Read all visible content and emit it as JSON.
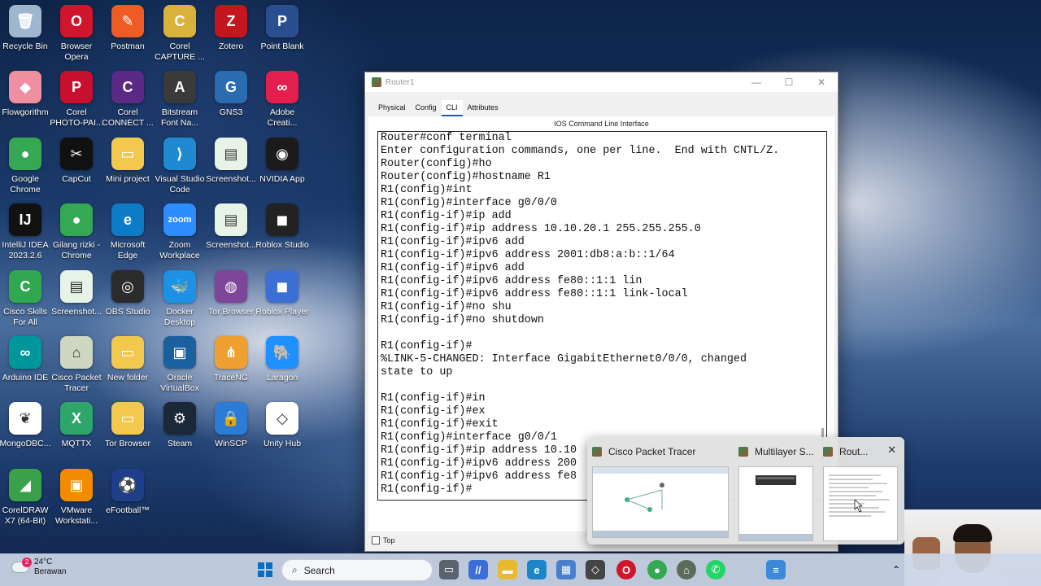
{
  "desktop": {
    "icons": [
      {
        "label": "Recycle Bin",
        "icon": "recycle-bin-icon",
        "color": "#9fb6cf",
        "glyph": "🗑"
      },
      {
        "label": "Browser Opera",
        "icon": "opera-icon",
        "color": "#d0152c",
        "glyph": "O"
      },
      {
        "label": "Postman",
        "icon": "postman-icon",
        "color": "#ef5b25",
        "glyph": "✎"
      },
      {
        "label": "Corel CAPTURE ...",
        "icon": "corel-capture-icon",
        "color": "#d9b23c",
        "glyph": "C"
      },
      {
        "label": "Zotero",
        "icon": "zotero-icon",
        "color": "#c4161c",
        "glyph": "Z"
      },
      {
        "label": "Point Blank",
        "icon": "point-blank-icon",
        "color": "#2a4e8f",
        "glyph": "P"
      },
      {
        "label": "Flowgorithm",
        "icon": "flowgorithm-icon",
        "color": "#f08fa0",
        "glyph": "◆"
      },
      {
        "label": "Corel PHOTO-PAI...",
        "icon": "corel-photopaint-icon",
        "color": "#c8102e",
        "glyph": "P"
      },
      {
        "label": "Corel CONNECT ...",
        "icon": "corel-connect-icon",
        "color": "#5b2a86",
        "glyph": "C"
      },
      {
        "label": "Bitstream Font Na...",
        "icon": "bitstream-icon",
        "color": "#3a3a3a",
        "glyph": "A"
      },
      {
        "label": "GNS3",
        "icon": "gns3-icon",
        "color": "#2b6cb0",
        "glyph": "G"
      },
      {
        "label": "Adobe Creati...",
        "icon": "adobe-cc-icon",
        "color": "#e3204d",
        "glyph": "∞"
      },
      {
        "label": "Google Chrome",
        "icon": "chrome-icon",
        "color": "#34a853",
        "glyph": "●"
      },
      {
        "label": "CapCut",
        "icon": "capcut-icon",
        "color": "#111111",
        "glyph": "✂"
      },
      {
        "label": "Mini project",
        "icon": "folder-icon",
        "color": "#f2c94c",
        "glyph": "▭"
      },
      {
        "label": "Visual Studio Code",
        "icon": "vscode-icon",
        "color": "#1f8ad2",
        "glyph": "⟩"
      },
      {
        "label": "Screenshot...",
        "icon": "screenshot-file-icon",
        "color": "#e8f3e8",
        "glyph": "▤"
      },
      {
        "label": "NVIDIA App",
        "icon": "nvidia-icon",
        "color": "#1b1b1b",
        "glyph": "◉"
      },
      {
        "label": "IntelliJ IDEA 2023.2.6",
        "icon": "intellij-icon",
        "color": "#111111",
        "glyph": "IJ"
      },
      {
        "label": "Gilang rizki - Chrome",
        "icon": "chrome-profile-icon",
        "color": "#34a853",
        "glyph": "●"
      },
      {
        "label": "Microsoft Edge",
        "icon": "edge-icon",
        "color": "#0c7cc6",
        "glyph": "e"
      },
      {
        "label": "Zoom Workplace",
        "icon": "zoom-icon",
        "color": "#2d8cff",
        "glyph": "zoom"
      },
      {
        "label": "Screenshot...",
        "icon": "screenshot-file-icon",
        "color": "#e8f3e8",
        "glyph": "▤"
      },
      {
        "label": "Roblox Studio",
        "icon": "roblox-studio-icon",
        "color": "#222222",
        "glyph": "◼"
      },
      {
        "label": "Cisco Skills For All",
        "icon": "cisco-skills-icon",
        "color": "#2fa84f",
        "glyph": "C"
      },
      {
        "label": "Screenshot...",
        "icon": "screenshot-file-icon",
        "color": "#e8f3e8",
        "glyph": "▤"
      },
      {
        "label": "OBS Studio",
        "icon": "obs-icon",
        "color": "#2b2b2b",
        "glyph": "◎"
      },
      {
        "label": "Docker Desktop",
        "icon": "docker-icon",
        "color": "#1d91e6",
        "glyph": "🐳"
      },
      {
        "label": "Tor Browser",
        "icon": "tor-icon",
        "color": "#7d4698",
        "glyph": "◍"
      },
      {
        "label": "Roblox Player",
        "icon": "roblox-player-icon",
        "color": "#3b6fd4",
        "glyph": "◼"
      },
      {
        "label": "Arduino IDE",
        "icon": "arduino-icon",
        "color": "#00979c",
        "glyph": "∞"
      },
      {
        "label": "Cisco Packet Tracer",
        "icon": "packet-tracer-icon",
        "color": "#cfd6c2",
        "glyph": "⌂"
      },
      {
        "label": "New folder",
        "icon": "folder-icon",
        "color": "#f2c94c",
        "glyph": "▭"
      },
      {
        "label": "Oracle VirtualBox",
        "icon": "virtualbox-icon",
        "color": "#1a5f9e",
        "glyph": "▣"
      },
      {
        "label": "TraceNG",
        "icon": "traceng-icon",
        "color": "#f0a030",
        "glyph": "⋔"
      },
      {
        "label": "Laragon",
        "icon": "laragon-icon",
        "color": "#1e90ff",
        "glyph": "🐘"
      },
      {
        "label": "MongoDBC...",
        "icon": "mongodb-icon",
        "color": "#ffffff",
        "glyph": "❦"
      },
      {
        "label": "MQTTX",
        "icon": "mqttx-icon",
        "color": "#2ea56b",
        "glyph": "X"
      },
      {
        "label": "Tor Browser",
        "icon": "folder-icon",
        "color": "#f2c94c",
        "glyph": "▭"
      },
      {
        "label": "Steam",
        "icon": "steam-icon",
        "color": "#1b2838",
        "glyph": "⚙"
      },
      {
        "label": "WinSCP",
        "icon": "winscp-icon",
        "color": "#2c7bd6",
        "glyph": "🔒"
      },
      {
        "label": "Unity Hub",
        "icon": "unity-icon",
        "color": "#ffffff",
        "glyph": "◇"
      },
      {
        "label": "CorelDRAW X7 (64-Bit)",
        "icon": "coreldraw-icon",
        "color": "#3aa14a",
        "glyph": "◢"
      },
      {
        "label": "VMware Workstati...",
        "icon": "vmware-icon",
        "color": "#f38b00",
        "glyph": "▣"
      },
      {
        "label": "eFootball™",
        "icon": "efootball-icon",
        "color": "#1f3f8a",
        "glyph": "⚽"
      }
    ]
  },
  "window": {
    "title": "Router1",
    "tabs": [
      {
        "label": "Physical",
        "active": false
      },
      {
        "label": "Config",
        "active": false
      },
      {
        "label": "CLI",
        "active": true
      },
      {
        "label": "Attributes",
        "active": false
      }
    ],
    "panel_title": "IOS Command Line Interface",
    "top_checkbox_label": "Top",
    "cli_lines": [
      "Router#conf terminal",
      "Enter configuration commands, one per line.  End with CNTL/Z.",
      "Router(config)#ho",
      "Router(config)#hostname R1",
      "R1(config)#int",
      "R1(config)#interface g0/0/0",
      "R1(config-if)#ip add",
      "R1(config-if)#ip address 10.10.20.1 255.255.255.0",
      "R1(config-if)#ipv6 add",
      "R1(config-if)#ipv6 address 2001:db8:a:b::1/64",
      "R1(config-if)#ipv6 add",
      "R1(config-if)#ipv6 address fe80::1:1 lin",
      "R1(config-if)#ipv6 address fe80::1:1 link-local",
      "R1(config-if)#no shu",
      "R1(config-if)#no shutdown",
      "",
      "R1(config-if)#",
      "%LINK-5-CHANGED: Interface GigabitEthernet0/0/0, changed",
      "state to up",
      "",
      "R1(config-if)#in",
      "R1(config-if)#ex",
      "R1(config-if)#exit",
      "R1(config)#interface g0/0/1",
      "R1(config-if)#ip address 10.10",
      "R1(config-if)#ipv6 address 200",
      "R1(config-if)#ipv6 address fe8",
      "R1(config-if)#"
    ]
  },
  "task_preview": {
    "items": [
      {
        "label": "Cisco Packet Tracer"
      },
      {
        "label": "Multilayer S..."
      },
      {
        "label": "Rout..."
      }
    ]
  },
  "taskbar": {
    "weather_temp": "24°C",
    "weather_desc": "Berawan",
    "weather_badge": "2",
    "search_label": "Search",
    "icons": [
      "windows-start-icon",
      "task-view-icon",
      "visual-studio-icon",
      "file-explorer-icon",
      "edge-icon",
      "store-icon",
      "unity-icon",
      "opera-icon",
      "chrome-icon",
      "packet-tracer-icon",
      "whatsapp-icon",
      "notepad-icon",
      "tray-chevron-icon"
    ]
  }
}
